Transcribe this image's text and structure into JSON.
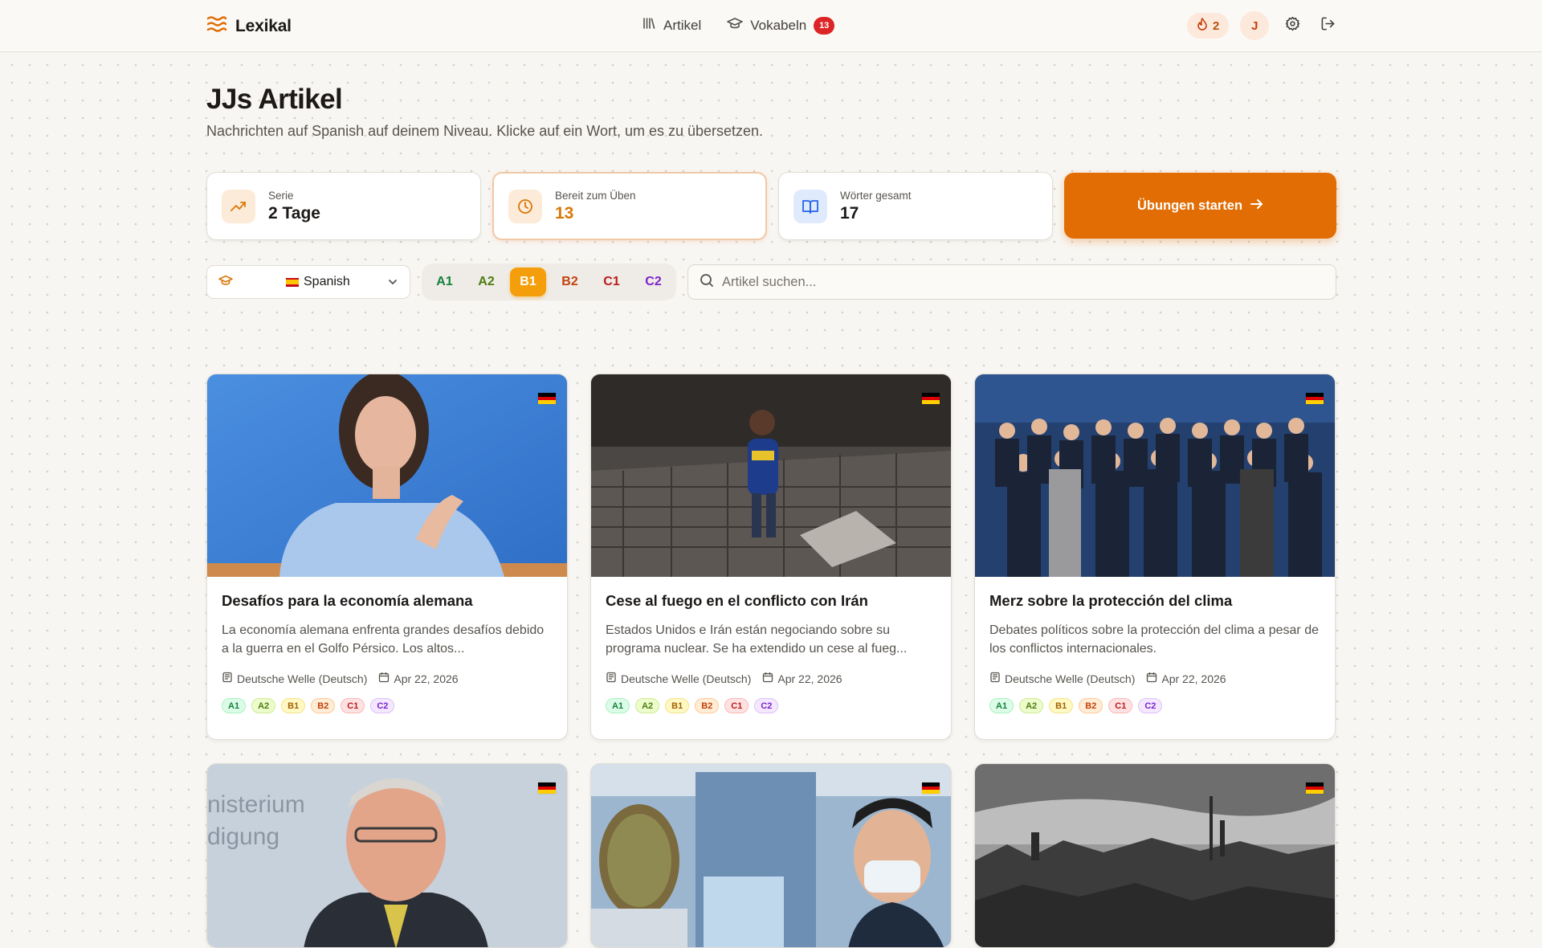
{
  "header": {
    "brand": "Lexikal",
    "nav": [
      {
        "label": "Artikel",
        "icon": "library-icon"
      },
      {
        "label": "Vokabeln",
        "icon": "graduation-cap-icon",
        "badge": "13"
      }
    ],
    "streak_count": "2",
    "avatar_initial": "J"
  },
  "page": {
    "title": "JJs Artikel",
    "subtitle": "Nachrichten auf Spanish auf deinem Niveau. Klicke auf ein Wort, um es zu übersetzen."
  },
  "stats": [
    {
      "label": "Serie",
      "value": "2 Tage",
      "icon": "trending-up-icon"
    },
    {
      "label": "Bereit zum Üben",
      "value": "13",
      "icon": "clock-icon"
    },
    {
      "label": "Wörter gesamt",
      "value": "17",
      "icon": "book-open-icon"
    }
  ],
  "cta_label": "Übungen starten",
  "filters": {
    "language": "Spanish",
    "levels": [
      "A1",
      "A2",
      "B1",
      "B2",
      "C1",
      "C2"
    ],
    "active_level": "B1",
    "search_placeholder": "Artikel suchen..."
  },
  "colors": {
    "accent": "#e16d04",
    "A1": "#15803d",
    "A2": "#4d7c0f",
    "B1": "#a16207",
    "B2": "#c2410c",
    "C1": "#b91c1c",
    "C2": "#7e22ce"
  },
  "articles": [
    {
      "title": "Desafíos para la economía alemana",
      "excerpt": "La economía alemana enfrenta grandes desafíos debido a la guerra en el Golfo Pérsico. Los altos...",
      "source": "Deutsche Welle (Deutsch)",
      "date": "Apr 22, 2026",
      "flag": "de-flag",
      "tags": [
        "A1",
        "A2",
        "B1",
        "B2",
        "C1",
        "C2"
      ]
    },
    {
      "title": "Cese al fuego en el conflicto con Irán",
      "excerpt": "Estados Unidos e Irán están negociando sobre su programa nuclear. Se ha extendido un cese al fueg...",
      "source": "Deutsche Welle (Deutsch)",
      "date": "Apr 22, 2026",
      "flag": "de-flag",
      "tags": [
        "A1",
        "A2",
        "B1",
        "B2",
        "C1",
        "C2"
      ]
    },
    {
      "title": "Merz sobre la protección del clima",
      "excerpt": "Debates políticos sobre la protección del clima a pesar de los conflictos internacionales.",
      "source": "Deutsche Welle (Deutsch)",
      "date": "Apr 22, 2026",
      "flag": "de-flag",
      "tags": [
        "A1",
        "A2",
        "B1",
        "B2",
        "C1",
        "C2"
      ]
    },
    {
      "flag": "de-flag",
      "image_text": [
        "nisterium",
        "digung"
      ]
    },
    {
      "flag": "de-flag"
    },
    {
      "flag": "de-flag"
    }
  ]
}
